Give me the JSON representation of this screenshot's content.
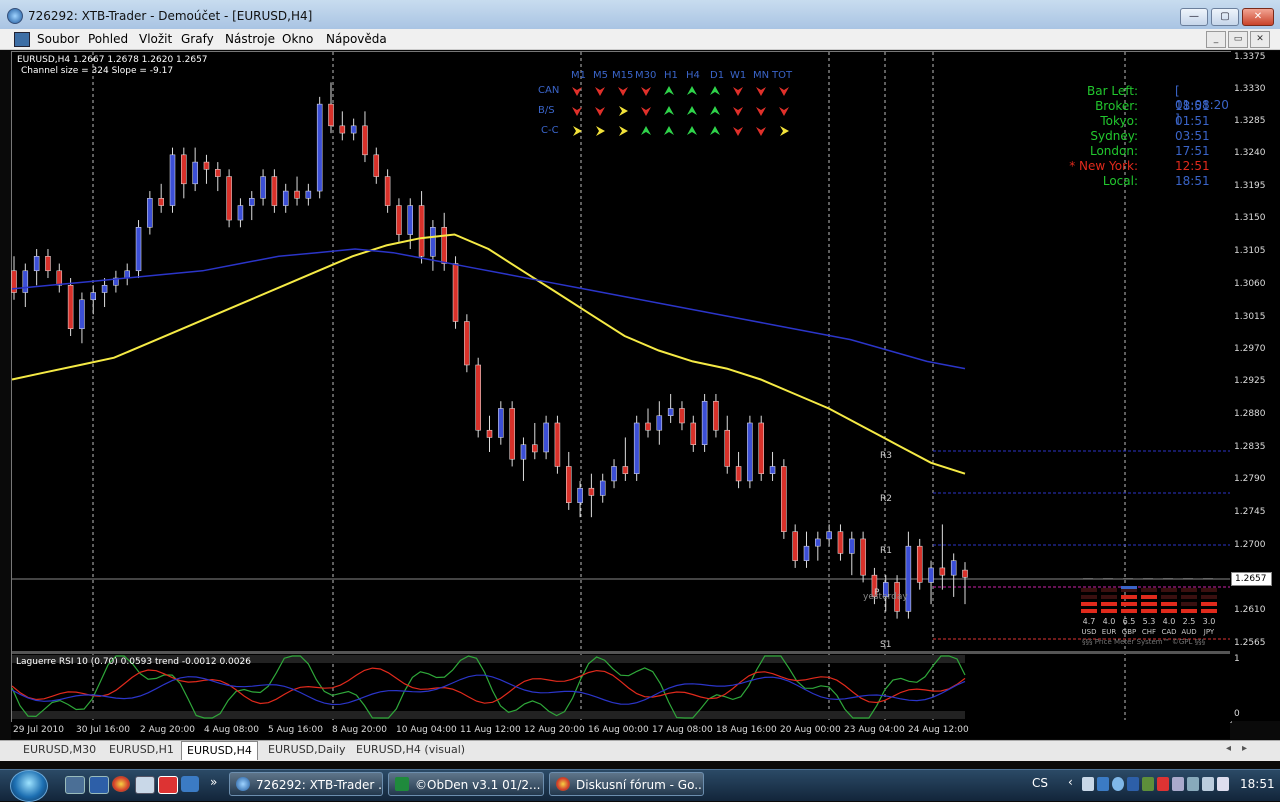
{
  "window": {
    "title": "726292: XTB-Trader - Demoúčet - [EURUSD,H4]",
    "minimize": "—",
    "maximize": "▢",
    "close": "✕"
  },
  "menu": [
    "Soubor",
    "Pohled",
    "Vložit",
    "Grafy",
    "Nástroje",
    "Okno",
    "Nápověda"
  ],
  "chart_info": {
    "line1": "EURUSD,H4  1.2667 1.2678 1.2620 1.2657",
    "line2": "Channel size = 324 Slope = -9.17"
  },
  "timeframe_indicator": {
    "headers": [
      "M1",
      "M5",
      "M15",
      "M30",
      "H1",
      "H4",
      "D1",
      "W1",
      "MN",
      "TOT"
    ],
    "rows": [
      {
        "label": "CAN",
        "states": [
          "down",
          "down",
          "down",
          "down",
          "up",
          "up",
          "up",
          "down",
          "down",
          "down"
        ]
      },
      {
        "label": "B/S",
        "states": [
          "down",
          "down",
          "flat",
          "down",
          "up",
          "up",
          "up",
          "down",
          "down",
          "down"
        ]
      },
      {
        "label": "C-C",
        "states": [
          "flat",
          "flat",
          "flat",
          "up",
          "up",
          "up",
          "up",
          "down",
          "down",
          "flat"
        ]
      }
    ],
    "colors": {
      "up": "#2fd34a",
      "down": "#e0302a",
      "flat": "#f2e23a"
    }
  },
  "clock_panel": [
    {
      "label": "Bar Left:",
      "value": "[ 01:08:20 ]",
      "color": "#22c72e"
    },
    {
      "label": "Broker:",
      "value": "18:51",
      "color": "#22c72e"
    },
    {
      "label": "Tokyo:",
      "value": "01:51",
      "color": "#22c72e"
    },
    {
      "label": "Sydney:",
      "value": "03:51",
      "color": "#22c72e"
    },
    {
      "label": "London:",
      "value": "17:51",
      "color": "#22c72e"
    },
    {
      "label": "* New York:",
      "value": "12:51",
      "color": "#e12a1c"
    },
    {
      "label": "Local:",
      "value": "18:51",
      "color": "#22c72e"
    }
  ],
  "price_axis": [
    "1.3375",
    "1.3330",
    "1.3285",
    "1.3240",
    "1.3195",
    "1.3150",
    "1.3105",
    "1.3060",
    "1.3015",
    "1.2970",
    "1.2925",
    "1.2880",
    "1.2835",
    "1.2790",
    "1.2745",
    "1.2700",
    "1.2610",
    "1.2565"
  ],
  "current_price": "1.2657",
  "pivots": {
    "r3": "R3",
    "r2": "R2",
    "r1": "R1",
    "p": "P",
    "s1": "S1",
    "yesterday": "yesterday"
  },
  "price_meter": {
    "currencies": [
      {
        "code": "USD",
        "value": "4.7"
      },
      {
        "code": "EUR",
        "value": "4.0"
      },
      {
        "code": "GBP",
        "value": "6.5"
      },
      {
        "code": "CHF",
        "value": "5.3"
      },
      {
        "code": "CAD",
        "value": "4.0"
      },
      {
        "code": "AUD",
        "value": "2.5"
      },
      {
        "code": "JPY",
        "value": "3.0"
      }
    ],
    "footer": "§§§ Price Meter System™ ©GPL §§§"
  },
  "subwindow": {
    "info": "Laguerre RSI 10 (0.70) 0.0593  trend -0.0012 0.0026",
    "scale_top": "1",
    "scale_bottom": "0"
  },
  "time_axis": [
    "29 Jul 2010",
    "30 Jul 16:00",
    "2 Aug 20:00",
    "4 Aug 08:00",
    "5 Aug 16:00",
    "8 Aug 20:00",
    "10 Aug 04:00",
    "11 Aug 12:00",
    "12 Aug 20:00",
    "16 Aug 00:00",
    "17 Aug 08:00",
    "18 Aug 16:00",
    "20 Aug 00:00",
    "23 Aug 04:00",
    "24 Aug 12:00"
  ],
  "chart_tabs": [
    "EURUSD,M30",
    "EURUSD,H1",
    "EURUSD,H4",
    "EURUSD,Daily",
    "EURUSD,H4 (visual)"
  ],
  "active_tab": "EURUSD,H4",
  "taskbar": {
    "quicklaunch_more": "»",
    "tasks": [
      {
        "label": "726292: XTB-Trader ..."
      },
      {
        "label": "©ObDen v3.1   01/2..."
      },
      {
        "label": "Diskusní fórum - Go..."
      }
    ],
    "lang": "CS",
    "clock": "18:51"
  },
  "chart_data": {
    "type": "candlestick",
    "symbol": "EURUSD",
    "timeframe": "H4",
    "ylim": [
      1.2565,
      1.3375
    ],
    "candles": [
      [
        1.308,
        1.31,
        1.304,
        1.305
      ],
      [
        1.305,
        1.309,
        1.303,
        1.308
      ],
      [
        1.308,
        1.311,
        1.306,
        1.31
      ],
      [
        1.31,
        1.311,
        1.307,
        1.308
      ],
      [
        1.308,
        1.309,
        1.305,
        1.306
      ],
      [
        1.306,
        1.307,
        1.299,
        1.3
      ],
      [
        1.3,
        1.305,
        1.298,
        1.304
      ],
      [
        1.304,
        1.306,
        1.302,
        1.305
      ],
      [
        1.305,
        1.307,
        1.303,
        1.306
      ],
      [
        1.306,
        1.308,
        1.305,
        1.307
      ],
      [
        1.307,
        1.309,
        1.306,
        1.308
      ],
      [
        1.308,
        1.315,
        1.307,
        1.314
      ],
      [
        1.314,
        1.319,
        1.313,
        1.318
      ],
      [
        1.318,
        1.32,
        1.316,
        1.317
      ],
      [
        1.317,
        1.325,
        1.316,
        1.324
      ],
      [
        1.324,
        1.325,
        1.318,
        1.32
      ],
      [
        1.32,
        1.325,
        1.319,
        1.323
      ],
      [
        1.323,
        1.324,
        1.32,
        1.322
      ],
      [
        1.322,
        1.323,
        1.319,
        1.321
      ],
      [
        1.321,
        1.322,
        1.314,
        1.315
      ],
      [
        1.315,
        1.318,
        1.314,
        1.317
      ],
      [
        1.317,
        1.319,
        1.315,
        1.318
      ],
      [
        1.318,
        1.322,
        1.317,
        1.321
      ],
      [
        1.321,
        1.322,
        1.316,
        1.317
      ],
      [
        1.317,
        1.32,
        1.316,
        1.319
      ],
      [
        1.319,
        1.321,
        1.317,
        1.318
      ],
      [
        1.318,
        1.32,
        1.317,
        1.319
      ],
      [
        1.319,
        1.332,
        1.318,
        1.331
      ],
      [
        1.331,
        1.334,
        1.327,
        1.328
      ],
      [
        1.328,
        1.33,
        1.326,
        1.327
      ],
      [
        1.327,
        1.329,
        1.326,
        1.328
      ],
      [
        1.328,
        1.33,
        1.323,
        1.324
      ],
      [
        1.324,
        1.325,
        1.32,
        1.321
      ],
      [
        1.321,
        1.322,
        1.316,
        1.317
      ],
      [
        1.317,
        1.318,
        1.312,
        1.313
      ],
      [
        1.313,
        1.318,
        1.311,
        1.317
      ],
      [
        1.317,
        1.319,
        1.309,
        1.31
      ],
      [
        1.31,
        1.315,
        1.308,
        1.314
      ],
      [
        1.314,
        1.316,
        1.308,
        1.309
      ],
      [
        1.309,
        1.31,
        1.3,
        1.301
      ],
      [
        1.301,
        1.302,
        1.294,
        1.295
      ],
      [
        1.295,
        1.296,
        1.285,
        1.286
      ],
      [
        1.286,
        1.288,
        1.283,
        1.285
      ],
      [
        1.285,
        1.29,
        1.284,
        1.289
      ],
      [
        1.289,
        1.29,
        1.281,
        1.282
      ],
      [
        1.282,
        1.285,
        1.279,
        1.284
      ],
      [
        1.284,
        1.287,
        1.282,
        1.283
      ],
      [
        1.283,
        1.288,
        1.282,
        1.287
      ],
      [
        1.287,
        1.288,
        1.28,
        1.281
      ],
      [
        1.281,
        1.283,
        1.275,
        1.276
      ],
      [
        1.276,
        1.279,
        1.274,
        1.278
      ],
      [
        1.278,
        1.28,
        1.274,
        1.277
      ],
      [
        1.277,
        1.28,
        1.276,
        1.279
      ],
      [
        1.279,
        1.282,
        1.278,
        1.281
      ],
      [
        1.281,
        1.285,
        1.279,
        1.28
      ],
      [
        1.28,
        1.288,
        1.279,
        1.287
      ],
      [
        1.287,
        1.289,
        1.285,
        1.286
      ],
      [
        1.286,
        1.29,
        1.284,
        1.288
      ],
      [
        1.288,
        1.291,
        1.287,
        1.289
      ],
      [
        1.289,
        1.29,
        1.286,
        1.287
      ],
      [
        1.287,
        1.288,
        1.283,
        1.284
      ],
      [
        1.284,
        1.291,
        1.283,
        1.29
      ],
      [
        1.29,
        1.291,
        1.285,
        1.286
      ],
      [
        1.286,
        1.288,
        1.28,
        1.281
      ],
      [
        1.281,
        1.283,
        1.278,
        1.279
      ],
      [
        1.279,
        1.288,
        1.278,
        1.287
      ],
      [
        1.287,
        1.288,
        1.279,
        1.28
      ],
      [
        1.28,
        1.283,
        1.279,
        1.281
      ],
      [
        1.281,
        1.282,
        1.271,
        1.272
      ],
      [
        1.272,
        1.273,
        1.267,
        1.268
      ],
      [
        1.268,
        1.272,
        1.267,
        1.27
      ],
      [
        1.27,
        1.272,
        1.268,
        1.271
      ],
      [
        1.271,
        1.273,
        1.27,
        1.272
      ],
      [
        1.272,
        1.273,
        1.268,
        1.269
      ],
      [
        1.269,
        1.272,
        1.266,
        1.271
      ],
      [
        1.271,
        1.272,
        1.265,
        1.266
      ],
      [
        1.266,
        1.267,
        1.262,
        1.263
      ],
      [
        1.263,
        1.266,
        1.261,
        1.265
      ],
      [
        1.265,
        1.266,
        1.26,
        1.261
      ],
      [
        1.261,
        1.272,
        1.26,
        1.27
      ],
      [
        1.27,
        1.271,
        1.264,
        1.265
      ],
      [
        1.265,
        1.268,
        1.262,
        1.267
      ],
      [
        1.267,
        1.273,
        1.264,
        1.266
      ],
      [
        1.266,
        1.269,
        1.263,
        1.268
      ],
      [
        1.2667,
        1.2678,
        1.262,
        1.2657
      ]
    ],
    "series": [
      {
        "name": "",
        "color": "#f5ea45",
        "values": [
          1.293,
          1.294,
          1.295,
          1.296,
          1.298,
          1.3,
          1.302,
          1.304,
          1.306,
          1.308,
          1.31,
          1.3115,
          1.3125,
          1.313,
          1.311,
          1.308,
          1.305,
          1.302,
          1.299,
          1.297,
          1.2955,
          1.2945,
          1.293,
          1.291,
          1.289,
          1.2865,
          1.284,
          1.2815,
          1.28
        ]
      },
      {
        "name": "",
        "color": "#2b35c9",
        "values": [
          1.3055,
          1.306,
          1.3065,
          1.307,
          1.3075,
          1.308,
          1.309,
          1.31,
          1.3105,
          1.311,
          1.3105,
          1.3095,
          1.3085,
          1.3075,
          1.3065,
          1.3055,
          1.3045,
          1.3035,
          1.3025,
          1.3015,
          1.3005,
          1.2995,
          1.2985,
          1.297,
          1.2955,
          1.2945
        ]
      }
    ],
    "laguerre_rsi": {
      "ylim": [
        0,
        1
      ]
    }
  }
}
